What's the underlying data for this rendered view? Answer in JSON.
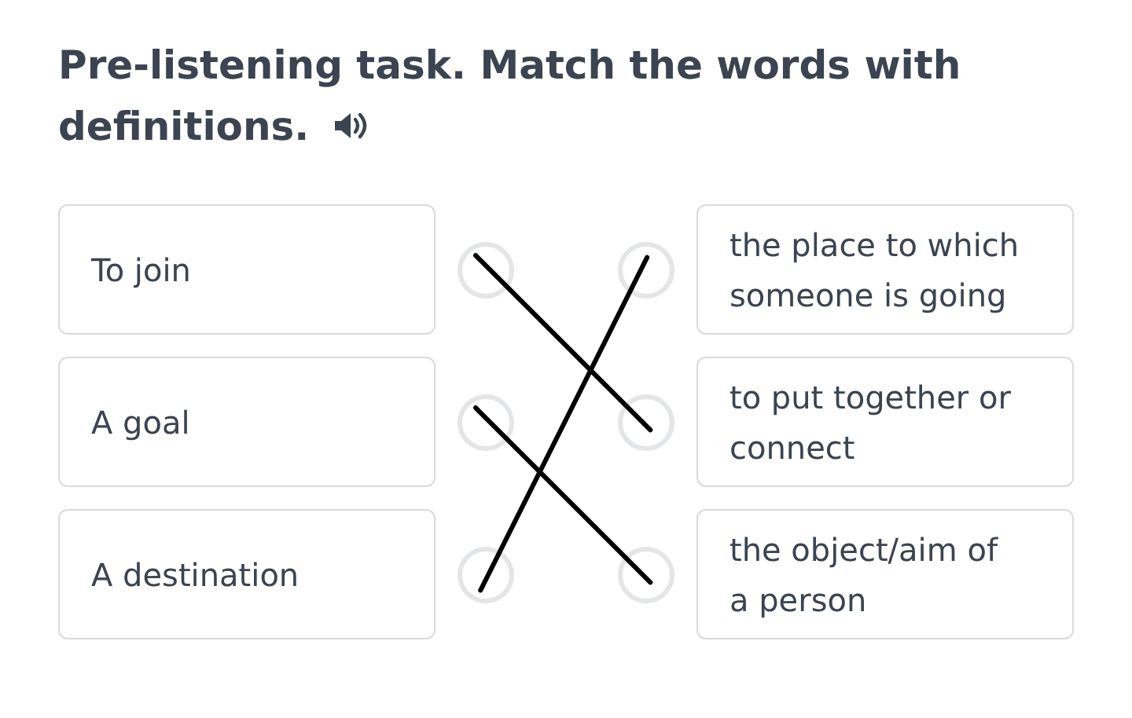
{
  "title_lines": [
    "Pre-listening task. Match the words with",
    "definitions."
  ],
  "left_items": [
    {
      "text": "To join",
      "links": [
        false,
        true,
        false
      ]
    },
    {
      "text": "A goal",
      "links": [
        false,
        false,
        true
      ]
    },
    {
      "text": "A destination",
      "links": [
        true,
        false,
        false
      ]
    }
  ],
  "right_items": [
    {
      "text": "the place to which someone is going"
    },
    {
      "text": "to put together or connect"
    },
    {
      "text": "the object/aim of a person"
    }
  ]
}
